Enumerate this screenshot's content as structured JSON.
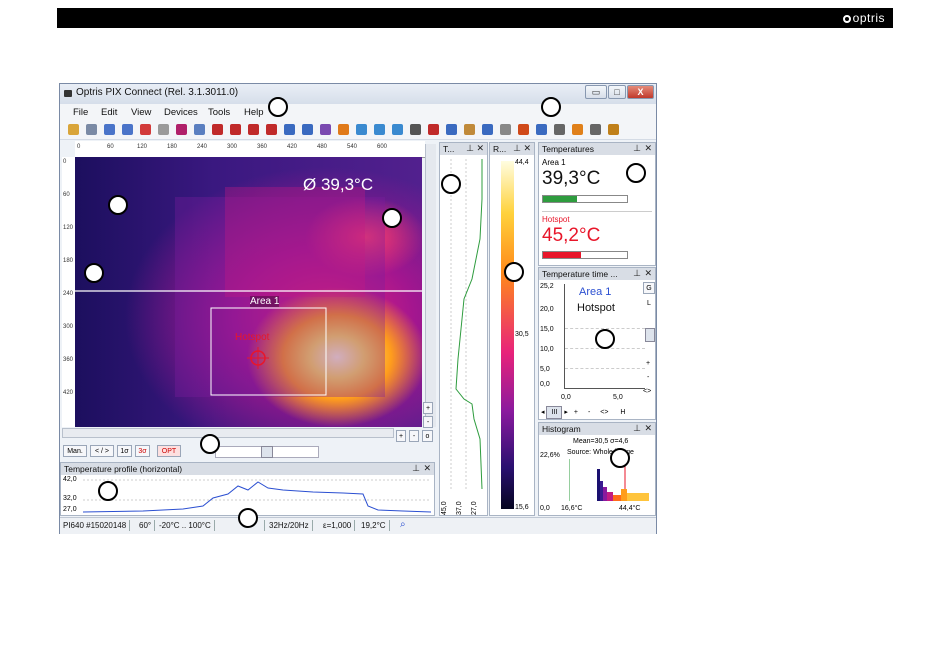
{
  "header": {
    "brand": "optris"
  },
  "window": {
    "title": "Optris PIX Connect (Rel. 3.1.3011.0)",
    "controls": {
      "minimize": "▭",
      "maximize": "□",
      "close": "X"
    },
    "menu": [
      "File",
      "Edit",
      "View",
      "Devices",
      "Tools",
      "Help"
    ]
  },
  "toolbar": {
    "icons": [
      "open-icon",
      "save-icon",
      "play-icon",
      "pause-icon",
      "record-icon",
      "snapshot-icon",
      "camera-icon",
      "copy-icon",
      "palette-icon",
      "palette2-icon",
      "layout-icon",
      "layout2-icon",
      "chart-icon",
      "histogram-icon",
      "eye-icon",
      "tag-icon",
      "line-chart-icon",
      "profile-icon",
      "graph-icon",
      "grid-icon",
      "line-icon",
      "bar-icon",
      "hand-icon",
      "fullscreen-icon",
      "image-icon",
      "marker-icon",
      "marker2-icon",
      "tools-icon",
      "thermo-icon",
      "settings-icon",
      "wizard-icon"
    ]
  },
  "image_view": {
    "ruler_x": [
      "0",
      "60",
      "120",
      "180",
      "240",
      "300",
      "360",
      "420",
      "480",
      "540",
      "600"
    ],
    "ruler_y": [
      "0",
      "60",
      "120",
      "180",
      "240",
      "300",
      "360",
      "420"
    ],
    "overlay_temp": "Ø 39,3°C",
    "area_label": "Area 1",
    "hotspot_label": "Hotspot"
  },
  "image_controls": {
    "buttons": [
      "Man.",
      "< / >",
      "1σ",
      "3σ",
      "OPT"
    ]
  },
  "profile_panel": {
    "title": "Temperature profile (horizontal)",
    "y_ticks": [
      "42,0",
      "32,0",
      "27,0"
    ]
  },
  "vprofile_panel": {
    "title": "T...",
    "x_ticks": [
      "45,0",
      "37,0",
      "27,0"
    ]
  },
  "scale_panel": {
    "title": "R...",
    "max": "44,4",
    "mid": "30,5",
    "min": "15,6"
  },
  "temperatures_panel": {
    "title": "Temperatures",
    "items": [
      {
        "label": "Area 1",
        "value": "39,3°C",
        "color": "#111111",
        "bar": "#2e9c3e"
      },
      {
        "label": "Hotspot",
        "value": "45,2°C",
        "color": "#e8162a",
        "bar": "#e8162a"
      }
    ]
  },
  "timeline_panel": {
    "title": "Temperature time ...",
    "y_ticks": [
      "25,2",
      "20,0",
      "15,0",
      "10,0",
      "5,0",
      "0,0"
    ],
    "x_ticks": [
      "0,0",
      "5,0"
    ],
    "legend": [
      "Area 1",
      "Hotspot"
    ],
    "side_buttons": [
      "G",
      "L",
      "+",
      "-",
      "<>",
      "H"
    ],
    "bottom_controls": [
      "III",
      "+",
      "-",
      "<>",
      "H"
    ]
  },
  "histogram_panel": {
    "title": "Histogram",
    "stats": "Mean=30,5 σ=4,6",
    "source": "Source: Whole image",
    "percent": "22,6%",
    "x_ticks": [
      "0,0",
      "16,6°C",
      "44,4°C"
    ]
  },
  "status_bar": [
    "PI640 #15020148",
    "60°",
    "-20°C .. 100°C",
    "",
    "32Hz/20Hz",
    "ε=1,000",
    "19,2°C"
  ],
  "colors": {
    "accent_blue": "#2b4fd1",
    "hotspot_red": "#e8162a",
    "area_green": "#2e9c3e"
  }
}
